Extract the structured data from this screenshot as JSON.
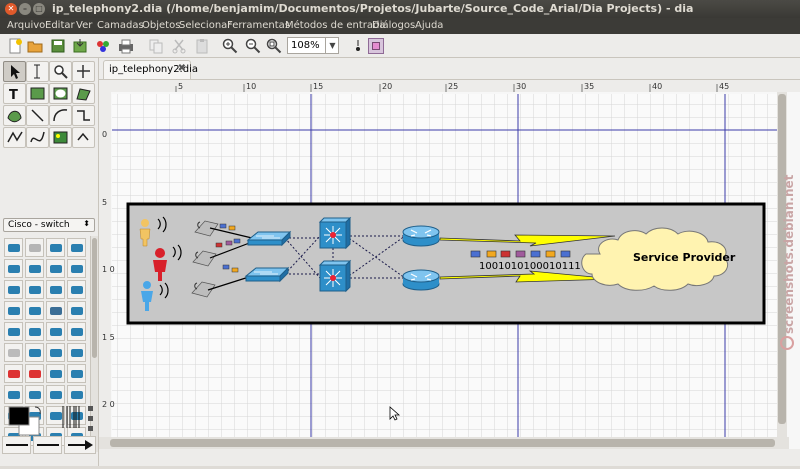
{
  "window": {
    "title": "ip_telephony2.dia (/home/benjamim/Documentos/Projetos/Jubarte/Source_Code_Arial/Dia Projects) - dia"
  },
  "menu": {
    "items": [
      "Arquivo",
      "Editar",
      "Ver",
      "Camadas",
      "Objetos",
      "Selecionar",
      "Ferramentas",
      "Métodos de entrada",
      "Diálogos",
      "Ajuda"
    ]
  },
  "toolbar": {
    "zoom_value": "108%"
  },
  "toolbox": {
    "sheet_selected": "Cisco - switch"
  },
  "tabs": [
    {
      "label": "ip_telephony2.dia"
    }
  ],
  "rulers": {
    "top_labels": [
      "5",
      "10",
      "15",
      "20",
      "25",
      "30",
      "35",
      "40",
      "45"
    ],
    "left_labels": [
      "0",
      "5",
      "1\n0",
      "1\n5",
      "2\n0"
    ]
  },
  "diagram": {
    "binary_string": "1001010100010111",
    "cloud_label": "Service Provider"
  },
  "watermark": "screenshots.debian.net",
  "colors": {
    "frame": "#000000",
    "frame_fill": "#c7c7c7",
    "guide": "#3a3aa8",
    "cloud": "#fff3b0",
    "lightning": "#ffff00",
    "device": "#2e8fc9",
    "titlebar": "#3c3b37"
  }
}
